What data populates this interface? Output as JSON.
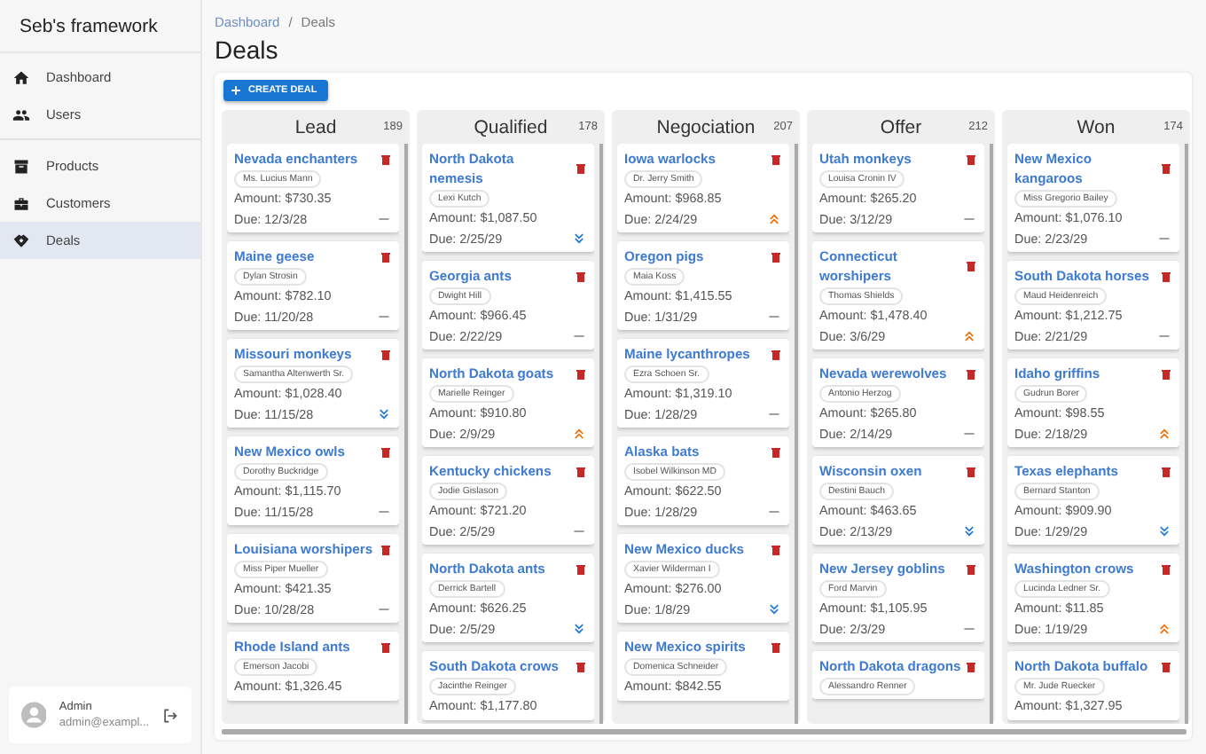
{
  "sidebar": {
    "title": "Seb's framework",
    "groups": [
      [
        {
          "label": "Dashboard",
          "selected": false
        },
        {
          "label": "Users",
          "selected": false
        }
      ],
      [
        {
          "label": "Products",
          "selected": false
        },
        {
          "label": "Customers",
          "selected": false
        },
        {
          "label": "Deals",
          "selected": true
        }
      ]
    ],
    "user": {
      "name": "Admin",
      "email": "admin@exampl..."
    }
  },
  "breadcrumbs": [
    "Dashboard",
    "Deals"
  ],
  "breadcrumb_separator": "/",
  "page_title": "Deals",
  "create_button": "CREATE DEAL",
  "columns": [
    {
      "title": "Lead",
      "count": "189",
      "cards": [
        {
          "title": "Nevada enchanters",
          "contact": "Ms. Lucius Mann",
          "amount": "Amount: $730.35",
          "due": "Due: 12/3/28",
          "high_priority": false,
          "low_priority": false
        },
        {
          "title": "Maine geese",
          "contact": "Dylan Strosin",
          "amount": "Amount: $782.10",
          "due": "Due: 11/20/28",
          "high_priority": false,
          "low_priority": false
        },
        {
          "title": "Missouri monkeys",
          "contact": "Samantha Altenwerth Sr.",
          "amount": "Amount: $1,028.40",
          "due": "Due: 11/15/28",
          "high_priority": false,
          "low_priority": true
        },
        {
          "title": "New Mexico owls",
          "contact": "Dorothy Buckridge",
          "amount": "Amount: $1,115.70",
          "due": "Due: 11/15/28",
          "high_priority": false,
          "low_priority": false
        },
        {
          "title": "Louisiana worshipers",
          "contact": "Miss Piper Mueller",
          "amount": "Amount: $421.35",
          "due": "Due: 10/28/28",
          "high_priority": false,
          "low_priority": false
        },
        {
          "title": "Rhode Island ants",
          "contact": "Emerson Jacobi",
          "amount": "Amount: $1,326.45"
        }
      ]
    },
    {
      "title": "Qualified",
      "count": "178",
      "cards": [
        {
          "title": "North Dakota nemesis",
          "contact": "Lexi Kutch",
          "amount": "Amount: $1,087.50",
          "due": "Due: 2/25/29",
          "high_priority": false,
          "low_priority": true
        },
        {
          "title": "Georgia ants",
          "contact": "Dwight Hill",
          "amount": "Amount: $966.45",
          "due": "Due: 2/22/29",
          "high_priority": false,
          "low_priority": false
        },
        {
          "title": "North Dakota goats",
          "contact": "Marielle Reinger",
          "amount": "Amount: $910.80",
          "due": "Due: 2/9/29",
          "high_priority": true,
          "low_priority": false
        },
        {
          "title": "Kentucky chickens",
          "contact": "Jodie Gislason",
          "amount": "Amount: $721.20",
          "due": "Due: 2/5/29",
          "high_priority": false,
          "low_priority": false
        },
        {
          "title": "North Dakota ants",
          "contact": "Derrick Bartell",
          "amount": "Amount: $626.25",
          "due": "Due: 2/5/29",
          "high_priority": false,
          "low_priority": true
        },
        {
          "title": "South Dakota crows",
          "contact": "Jacinthe Reinger",
          "amount": "Amount: $1,177.80"
        }
      ]
    },
    {
      "title": "Negociation",
      "count": "207",
      "cards": [
        {
          "title": "Iowa warlocks",
          "contact": "Dr. Jerry Smith",
          "amount": "Amount: $968.85",
          "due": "Due: 2/24/29",
          "high_priority": true,
          "low_priority": false
        },
        {
          "title": "Oregon pigs",
          "contact": "Maia Koss",
          "amount": "Amount: $1,415.55",
          "due": "Due: 1/31/29",
          "high_priority": false,
          "low_priority": false
        },
        {
          "title": "Maine lycanthropes",
          "contact": "Ezra Schoen Sr.",
          "amount": "Amount: $1,319.10",
          "due": "Due: 1/28/29",
          "high_priority": false,
          "low_priority": false
        },
        {
          "title": "Alaska bats",
          "contact": "Isobel Wilkinson MD",
          "amount": "Amount: $622.50",
          "due": "Due: 1/28/29",
          "high_priority": false,
          "low_priority": false
        },
        {
          "title": "New Mexico ducks",
          "contact": "Xavier Wilderman I",
          "amount": "Amount: $276.00",
          "due": "Due: 1/8/29",
          "high_priority": false,
          "low_priority": true
        },
        {
          "title": "New Mexico spirits",
          "contact": "Domenica Schneider",
          "amount": "Amount: $842.55"
        }
      ]
    },
    {
      "title": "Offer",
      "count": "212",
      "cards": [
        {
          "title": "Utah monkeys",
          "contact": "Louisa Cronin IV",
          "amount": "Amount: $265.20",
          "due": "Due: 3/12/29",
          "high_priority": false,
          "low_priority": false
        },
        {
          "title": "Connecticut worshipers",
          "contact": "Thomas Shields",
          "amount": "Amount: $1,478.40",
          "due": "Due: 3/6/29",
          "high_priority": true,
          "low_priority": false
        },
        {
          "title": "Nevada werewolves",
          "contact": "Antonio Herzog",
          "amount": "Amount: $265.80",
          "due": "Due: 2/14/29",
          "high_priority": false,
          "low_priority": false
        },
        {
          "title": "Wisconsin oxen",
          "contact": "Destini Bauch",
          "amount": "Amount: $463.65",
          "due": "Due: 2/13/29",
          "high_priority": false,
          "low_priority": true
        },
        {
          "title": "New Jersey goblins",
          "contact": "Ford Marvin",
          "amount": "Amount: $1,105.95",
          "due": "Due: 2/3/29",
          "high_priority": false,
          "low_priority": false
        },
        {
          "title": "North Dakota dragons",
          "contact": "Alessandro Renner"
        }
      ]
    },
    {
      "title": "Won",
      "count": "174",
      "cards": [
        {
          "title": "New Mexico kangaroos",
          "contact": "Miss Gregorio Bailey",
          "amount": "Amount: $1,076.10",
          "due": "Due: 2/23/29",
          "high_priority": false,
          "low_priority": false
        },
        {
          "title": "South Dakota horses",
          "contact": "Maud Heidenreich",
          "amount": "Amount: $1,212.75",
          "due": "Due: 2/21/29",
          "high_priority": false,
          "low_priority": false
        },
        {
          "title": "Idaho griffins",
          "contact": "Gudrun Borer",
          "amount": "Amount: $98.55",
          "due": "Due: 2/18/29",
          "high_priority": true,
          "low_priority": false
        },
        {
          "title": "Texas elephants",
          "contact": "Bernard Stanton",
          "amount": "Amount: $909.90",
          "due": "Due: 1/29/29",
          "high_priority": false,
          "low_priority": true
        },
        {
          "title": "Washington crows",
          "contact": "Lucinda Ledner Sr.",
          "amount": "Amount: $11.85",
          "due": "Due: 1/19/29",
          "high_priority": true,
          "low_priority": false
        },
        {
          "title": "North Dakota buffalo",
          "contact": "Mr. Jude Ruecker",
          "amount": "Amount: $1,327.95"
        }
      ]
    }
  ]
}
